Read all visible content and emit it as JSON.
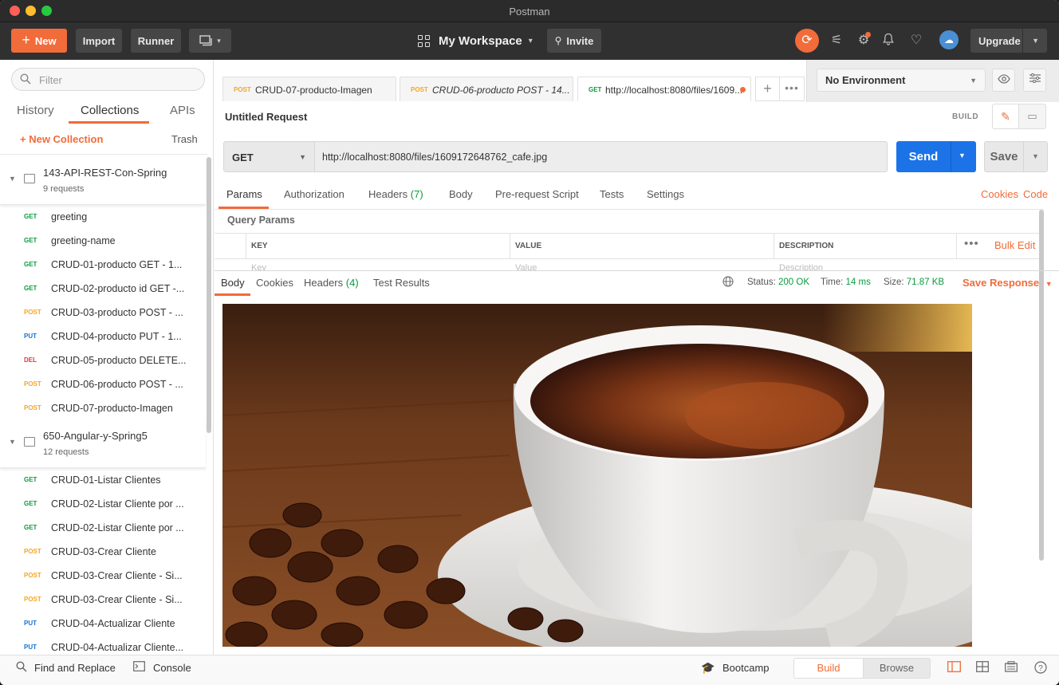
{
  "window": {
    "title": "Postman"
  },
  "header": {
    "new_label": "New",
    "import_label": "Import",
    "runner_label": "Runner",
    "workspace_label": "My Workspace",
    "invite_label": "Invite",
    "upgrade_label": "Upgrade"
  },
  "sidebar": {
    "filter_placeholder": "Filter",
    "tabs": [
      "History",
      "Collections",
      "APIs"
    ],
    "active_tab": "Collections",
    "new_collection_label": "+ New Collection",
    "trash_label": "Trash",
    "collections": [
      {
        "name": "143-API-REST-Con-Spring",
        "count": "9 requests",
        "requests": [
          {
            "method": "GET",
            "name": "greeting"
          },
          {
            "method": "GET",
            "name": "greeting-name"
          },
          {
            "method": "GET",
            "name": "CRUD-01-producto GET - 1..."
          },
          {
            "method": "GET",
            "name": "CRUD-02-producto id GET -..."
          },
          {
            "method": "POST",
            "name": "CRUD-03-producto POST - ..."
          },
          {
            "method": "PUT",
            "name": "CRUD-04-producto PUT - 1..."
          },
          {
            "method": "DEL",
            "name": "CRUD-05-producto DELETE..."
          },
          {
            "method": "POST",
            "name": "CRUD-06-producto POST - ..."
          },
          {
            "method": "POST",
            "name": "CRUD-07-producto-Imagen"
          }
        ]
      },
      {
        "name": "650-Angular-y-Spring5",
        "count": "12 requests",
        "requests": [
          {
            "method": "GET",
            "name": "CRUD-01-Listar Clientes"
          },
          {
            "method": "GET",
            "name": "CRUD-02-Listar Cliente por ..."
          },
          {
            "method": "GET",
            "name": "CRUD-02-Listar Cliente por ..."
          },
          {
            "method": "POST",
            "name": "CRUD-03-Crear Cliente"
          },
          {
            "method": "POST",
            "name": "CRUD-03-Crear Cliente - Si..."
          },
          {
            "method": "POST",
            "name": "CRUD-03-Crear Cliente - Si..."
          },
          {
            "method": "PUT",
            "name": "CRUD-04-Actualizar Cliente"
          },
          {
            "method": "PUT",
            "name": "CRUD-04-Actualizar Cliente..."
          }
        ]
      }
    ]
  },
  "tabs": [
    {
      "method": "POST",
      "title": "CRUD-07-producto-Imagen",
      "italic": false
    },
    {
      "method": "POST",
      "title": "CRUD-06-producto POST - 14...",
      "italic": true
    },
    {
      "method": "GET",
      "title": "http://localhost:8080/files/1609...",
      "italic": false,
      "active": true,
      "unsaved": true
    }
  ],
  "environment": {
    "selected": "No Environment"
  },
  "request": {
    "title": "Untitled Request",
    "build_label": "BUILD",
    "method": "GET",
    "url": "http://localhost:8080/files/1609172648762_cafe.jpg",
    "send_label": "Send",
    "save_label": "Save",
    "tabs": {
      "params": "Params",
      "authorization": "Authorization",
      "headers": "Headers",
      "headers_count": "(7)",
      "body": "Body",
      "prerequest": "Pre-request Script",
      "tests": "Tests",
      "settings": "Settings"
    },
    "cookies_link": "Cookies",
    "code_link": "Code",
    "query_params_label": "Query Params",
    "columns": [
      "KEY",
      "VALUE",
      "DESCRIPTION"
    ],
    "placeholders": [
      "Key",
      "Value",
      "Description"
    ],
    "bulk_edit_label": "Bulk Edit"
  },
  "response": {
    "tabs": {
      "body": "Body",
      "cookies": "Cookies",
      "headers": "Headers",
      "headers_count": "(4)",
      "test_results": "Test Results"
    },
    "status_label": "Status:",
    "status_value": "200 OK",
    "time_label": "Time:",
    "time_value": "14 ms",
    "size_label": "Size:",
    "size_value": "71.87 KB",
    "save_response_label": "Save Response"
  },
  "footer": {
    "find_replace": "Find and Replace",
    "console": "Console",
    "bootcamp": "Bootcamp",
    "build": "Build",
    "browse": "Browse"
  },
  "colors": {
    "accent": "#f26b3a",
    "send": "#1c73e8",
    "get": "#0a9a3e",
    "post": "#f5a623",
    "put": "#1473d4",
    "delete": "#e0363a"
  }
}
